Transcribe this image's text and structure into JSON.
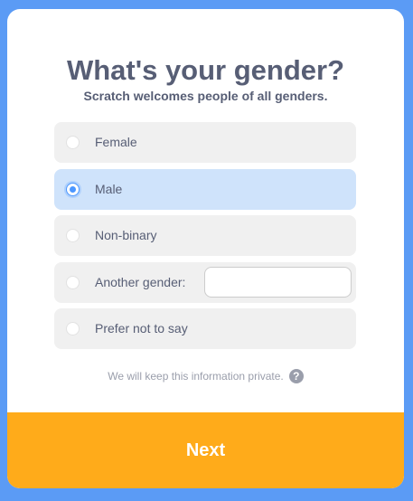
{
  "dialog": {
    "title": "What's your gender?",
    "subtitle": "Scratch welcomes people of all genders."
  },
  "options": [
    {
      "label": "Female",
      "selected": false
    },
    {
      "label": "Male",
      "selected": true
    },
    {
      "label": "Non-binary",
      "selected": false
    },
    {
      "label": "Another gender:",
      "selected": false,
      "input_value": "",
      "input_placeholder": ""
    },
    {
      "label": "Prefer not to say",
      "selected": false
    }
  ],
  "privacy_note": "We will keep this information private.",
  "help_icon": {
    "icon": "question-mark-icon",
    "glyph": "?"
  },
  "next_button": {
    "label": "Next"
  },
  "colors": {
    "frame": "#5b9bf5",
    "selected_option": "#cfe3fb",
    "radio_accent": "#4c97ff",
    "next_button": "#ffab1a",
    "text": "#575e75"
  }
}
